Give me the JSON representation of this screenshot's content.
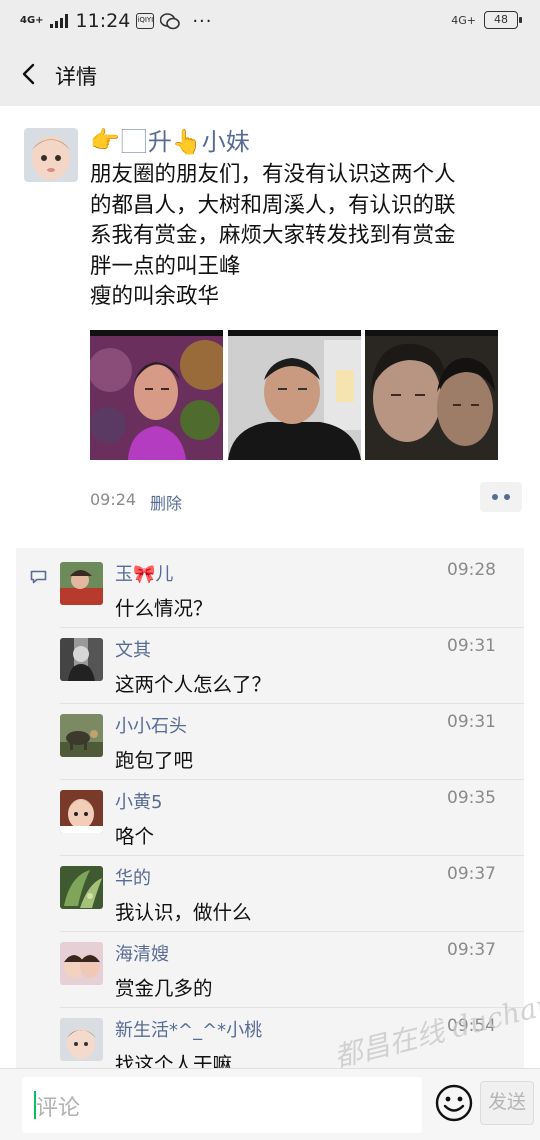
{
  "status_bar": {
    "network": "4G+",
    "time": "11:24",
    "app_icon_1": "iQIYI",
    "battery": "48",
    "icons": [
      "signal-icon",
      "iqiyi-icon",
      "wechat-icon",
      "more-icon",
      "battery-icon"
    ]
  },
  "header": {
    "title": "详情",
    "back_icon": "chevron-left-icon"
  },
  "post": {
    "author_emoji_1": "👉",
    "author_emoji_2": "🏻",
    "author_name": "升👆小妹",
    "text_lines": [
      "朋友圈的朋友们，有没有认识这两个人",
      "的都昌人，大树和周溪人，有认识的联",
      "系我有赏金，麻烦大家转发找到有赏金",
      "胖一点的叫王峰",
      "瘦的叫余政华"
    ],
    "time": "09:24",
    "delete_label": "删除",
    "photo_count": 3
  },
  "comments": [
    {
      "name": "玉🎀儿",
      "time": "09:28",
      "text": "什么情况？"
    },
    {
      "name": "文其",
      "time": "09:31",
      "text": "这两个人怎么了？"
    },
    {
      "name": "小小石头",
      "time": "09:31",
      "text": "跑包了吧"
    },
    {
      "name": "小黄5",
      "time": "09:35",
      "text": "咯个"
    },
    {
      "name": "华的",
      "time": "09:37",
      "text": "我认识，做什么"
    },
    {
      "name": "海清嫂",
      "time": "09:37",
      "text": "赏金几多的"
    },
    {
      "name": "新生活*^_^*小桃",
      "time": "09:54",
      "text": "找这个人干嘛"
    }
  ],
  "watermark": "都昌在线 duchang.org",
  "input": {
    "placeholder": "评论",
    "send_label": "发送"
  },
  "colors": {
    "link": "#576b95",
    "accent": "#07c160",
    "background": "#ededed"
  }
}
